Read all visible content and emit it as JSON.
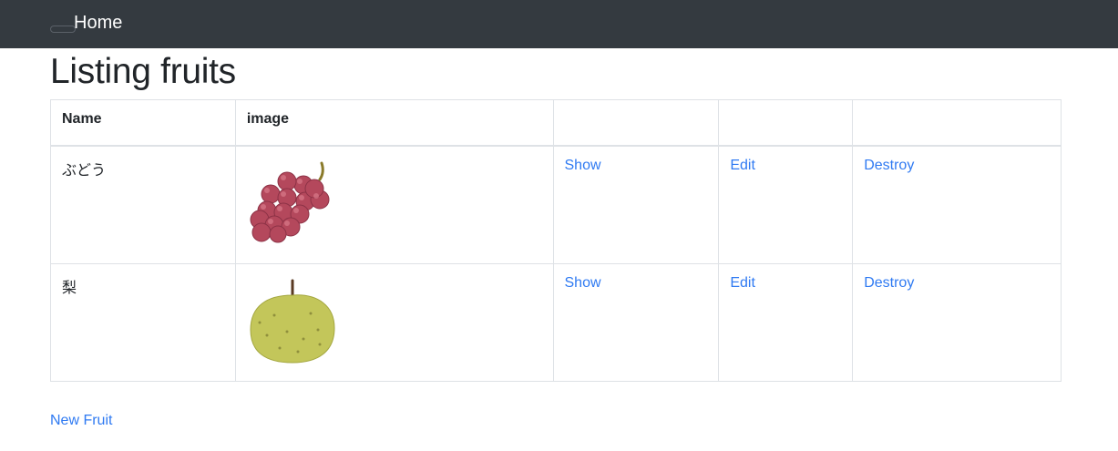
{
  "navbar": {
    "brand": "Home"
  },
  "page": {
    "title": "Listing fruits"
  },
  "table": {
    "headers": [
      "Name",
      "image",
      "",
      "",
      ""
    ],
    "rows": [
      {
        "name": "ぶどう",
        "image_icon": "grapes-image",
        "show": "Show",
        "edit": "Edit",
        "destroy": "Destroy"
      },
      {
        "name": "梨",
        "image_icon": "pear-image",
        "show": "Show",
        "edit": "Edit",
        "destroy": "Destroy"
      }
    ]
  },
  "actions": {
    "new_label": "New Fruit"
  },
  "colors": {
    "navbar_bg": "#343a40",
    "link": "#2f7af2",
    "border": "#dee2e6"
  }
}
